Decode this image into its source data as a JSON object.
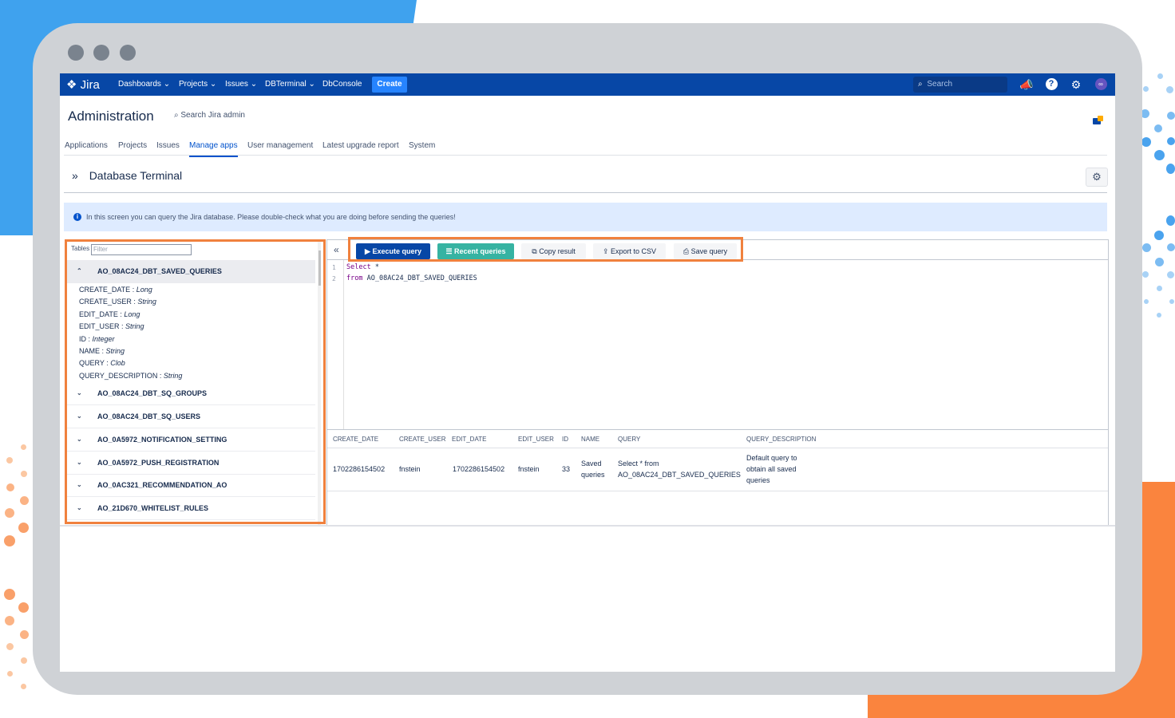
{
  "colors": {
    "nav_bg": "#0747a6",
    "accent_orange": "#f0813e",
    "primary_button": "#0747a6",
    "teal_button": "#36b3a2",
    "info_bg": "#deebff"
  },
  "topnav": {
    "logo": "Jira",
    "items": [
      "Dashboards",
      "Projects",
      "Issues",
      "DBTerminal",
      "DbConsole"
    ],
    "create_label": "Create",
    "search_placeholder": "Search",
    "icons": [
      "megaphone-icon",
      "help-icon",
      "settings-icon",
      "avatar-icon"
    ]
  },
  "admin": {
    "title": "Administration",
    "search_label": "Search Jira admin",
    "tabs": [
      "Applications",
      "Projects",
      "Issues",
      "Manage apps",
      "User management",
      "Latest upgrade report",
      "System"
    ],
    "active_tab": "Manage apps"
  },
  "page": {
    "title": "Database Terminal",
    "info_message": "In this screen you can query the Jira database. Please double-check what you are doing before sending the queries!"
  },
  "tables_panel": {
    "label": "Tables",
    "filter_placeholder": "Filter",
    "expanded_table": "AO_08AC24_DBT_SAVED_QUERIES",
    "columns": [
      {
        "name": "CREATE_DATE",
        "type": "Long"
      },
      {
        "name": "CREATE_USER",
        "type": "String"
      },
      {
        "name": "EDIT_DATE",
        "type": "Long"
      },
      {
        "name": "EDIT_USER",
        "type": "String"
      },
      {
        "name": "ID",
        "type": "Integer"
      },
      {
        "name": "NAME",
        "type": "String"
      },
      {
        "name": "QUERY",
        "type": "Clob"
      },
      {
        "name": "QUERY_DESCRIPTION",
        "type": "String"
      }
    ],
    "collapsed_tables": [
      "AO_08AC24_DBT_SQ_GROUPS",
      "AO_08AC24_DBT_SQ_USERS",
      "AO_0A5972_NOTIFICATION_SETTING",
      "AO_0A5972_PUSH_REGISTRATION",
      "AO_0AC321_RECOMMENDATION_AO",
      "AO_21D670_WHITELIST_RULES"
    ]
  },
  "toolbar": {
    "collapse_label": "«",
    "execute": "Execute query",
    "recent": "Recent queries",
    "copy": "Copy result",
    "export": "Export to CSV",
    "save": "Save query"
  },
  "editor": {
    "line1_kw": "Select",
    "line1_rest": " *",
    "line2_kw": "from",
    "line2_rest": " AO_08AC24_DBT_SAVED_QUERIES"
  },
  "results": {
    "headers": [
      "CREATE_DATE",
      "CREATE_USER",
      "EDIT_DATE",
      "EDIT_USER",
      "ID",
      "NAME",
      "QUERY",
      "QUERY_DESCRIPTION"
    ],
    "row": {
      "create_date": "1702286154502",
      "create_user": "fnstein",
      "edit_date": "1702286154502",
      "edit_user": "fnstein",
      "id": "33",
      "name_1": "Saved",
      "name_2": "queries",
      "query_1": "Select * from",
      "query_2": "AO_08AC24_DBT_SAVED_QUERIES",
      "desc_1": "Default query to",
      "desc_2": "obtain all saved",
      "desc_3": "queries"
    }
  }
}
